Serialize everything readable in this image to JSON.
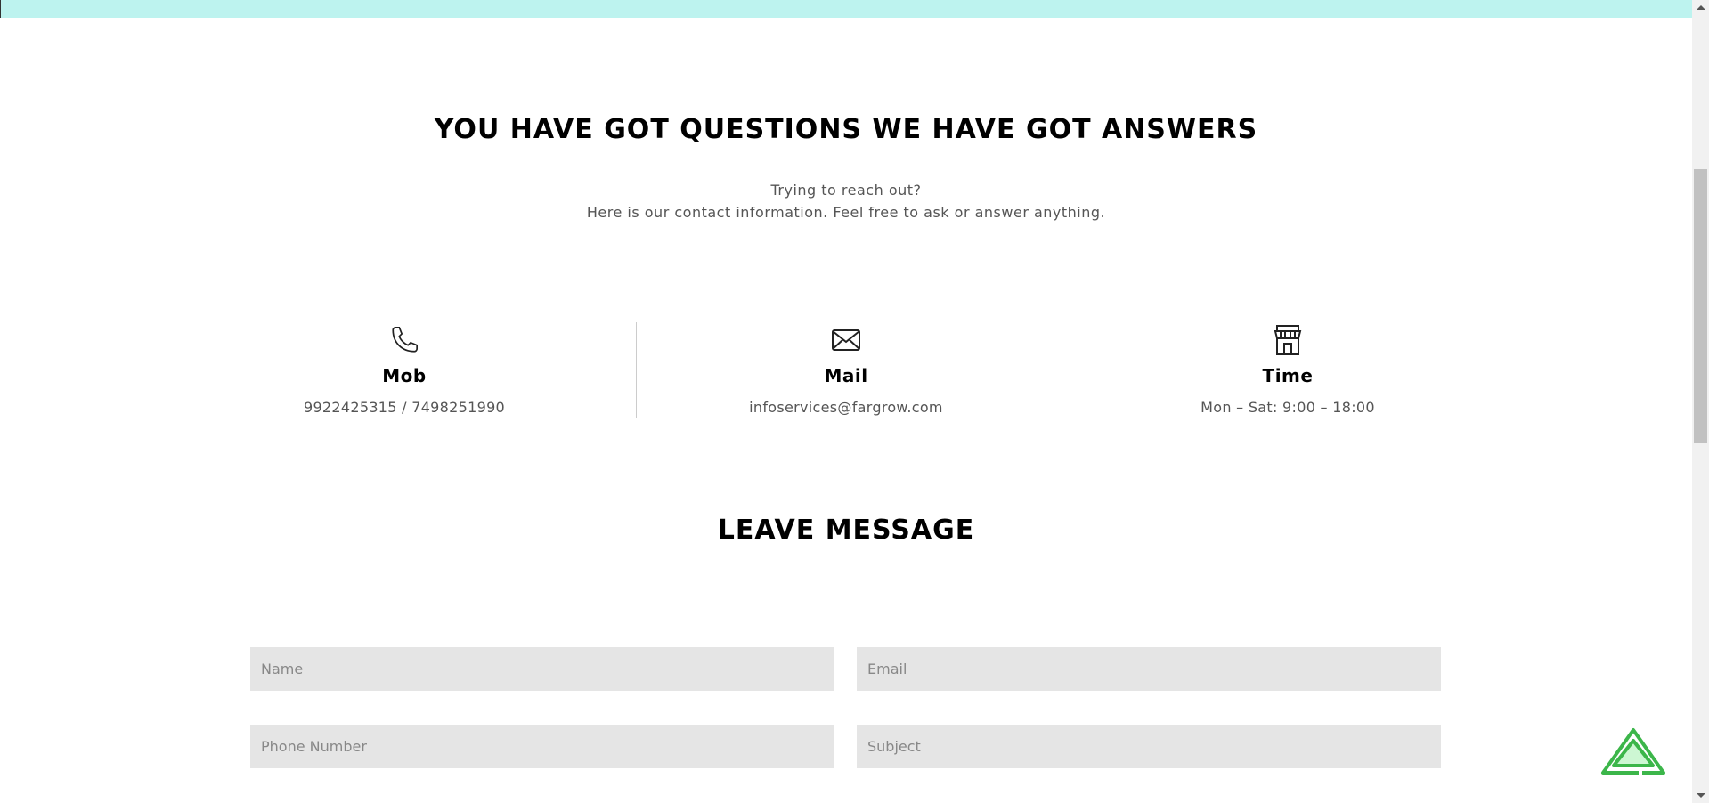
{
  "heading": "YOU HAVE GOT QUESTIONS WE HAVE GOT ANSWERS",
  "subtitle_line1": "Trying to reach out?",
  "subtitle_line2": "Here is our contact information. Feel free to ask or answer anything.",
  "contacts": [
    {
      "icon": "phone-icon",
      "label": "Mob",
      "value": "9922425315 / 7498251990"
    },
    {
      "icon": "mail-icon",
      "label": "Mail",
      "value": "infoservices@fargrow.com"
    },
    {
      "icon": "store-icon",
      "label": "Time",
      "value": "Mon – Sat: 9:00 – 18:00"
    }
  ],
  "form": {
    "title": "LEAVE MESSAGE",
    "name_placeholder": "Name",
    "email_placeholder": "Email",
    "phone_placeholder": "Phone Number",
    "subject_placeholder": "Subject"
  },
  "colors": {
    "top_band": "#bdf3ef",
    "input_bg": "#e5e5e5",
    "fab_green": "#3cb64a"
  }
}
